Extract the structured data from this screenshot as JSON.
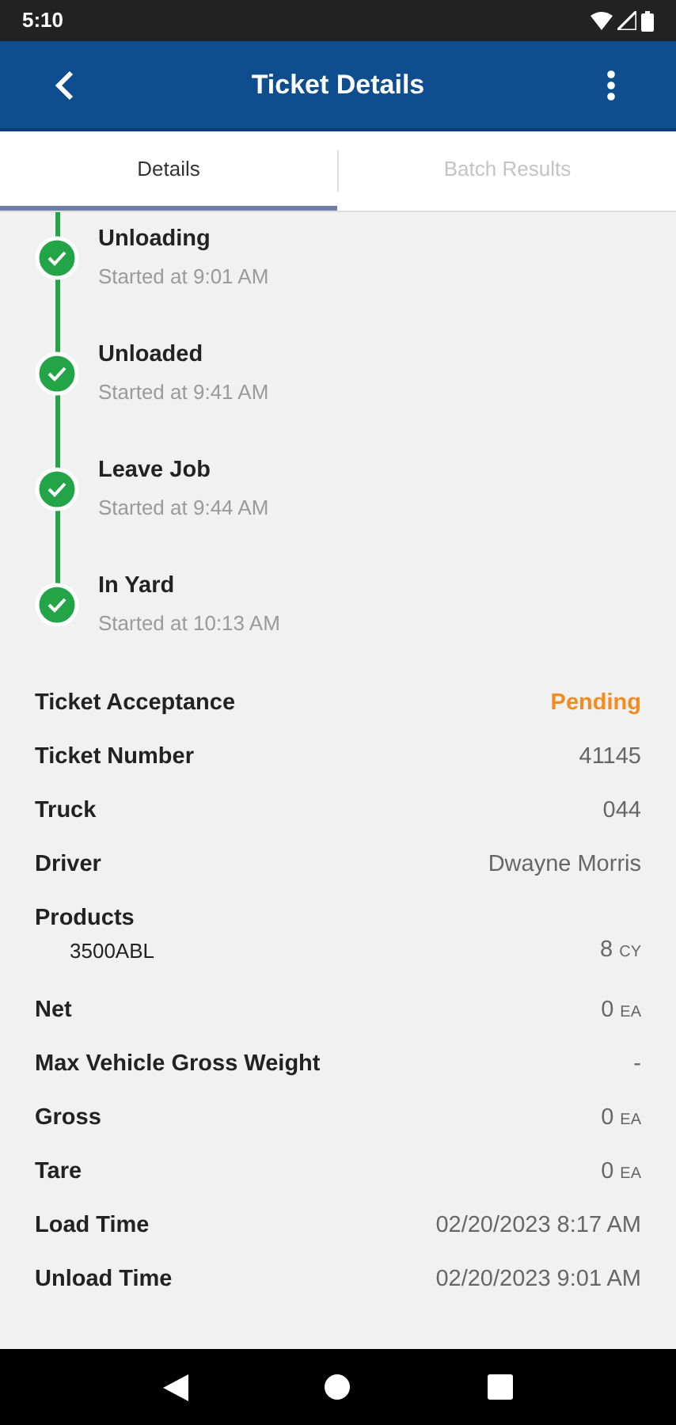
{
  "status_bar": {
    "time": "5:10"
  },
  "app_bar": {
    "title": "Ticket Details"
  },
  "tabs": [
    {
      "label": "Details",
      "selected": true
    },
    {
      "label": "Batch Results",
      "selected": false
    }
  ],
  "timeline": [
    {
      "title": "Unloading",
      "subtitle": "Started at 9:01 AM",
      "done": true
    },
    {
      "title": "Unloaded",
      "subtitle": "Started at 9:41 AM",
      "done": true
    },
    {
      "title": "Leave Job",
      "subtitle": "Started at 9:44 AM",
      "done": true
    },
    {
      "title": "In Yard",
      "subtitle": "Started at 10:13 AM",
      "done": true
    }
  ],
  "details": [
    {
      "kind": "status",
      "label": "Ticket Acceptance",
      "value": "Pending"
    },
    {
      "kind": "row",
      "label": "Ticket Number",
      "value": "41145"
    },
    {
      "kind": "row",
      "label": "Truck",
      "value": "044"
    },
    {
      "kind": "row",
      "label": "Driver",
      "value": "Dwayne Morris"
    },
    {
      "kind": "heading",
      "label": "Products"
    },
    {
      "kind": "product",
      "label": "3500ABL",
      "value": "8",
      "unit": "CY"
    },
    {
      "kind": "row",
      "label": "Net",
      "value": "0",
      "unit": "EA"
    },
    {
      "kind": "row",
      "label": "Max Vehicle Gross Weight",
      "value": "-"
    },
    {
      "kind": "row",
      "label": "Gross",
      "value": "0",
      "unit": "EA"
    },
    {
      "kind": "row",
      "label": "Tare",
      "value": "0",
      "unit": "EA"
    },
    {
      "kind": "row",
      "label": "Load Time",
      "value": "02/20/2023 8:17 AM"
    },
    {
      "kind": "row",
      "label": "Unload Time",
      "value": "02/20/2023 9:01 AM"
    }
  ]
}
